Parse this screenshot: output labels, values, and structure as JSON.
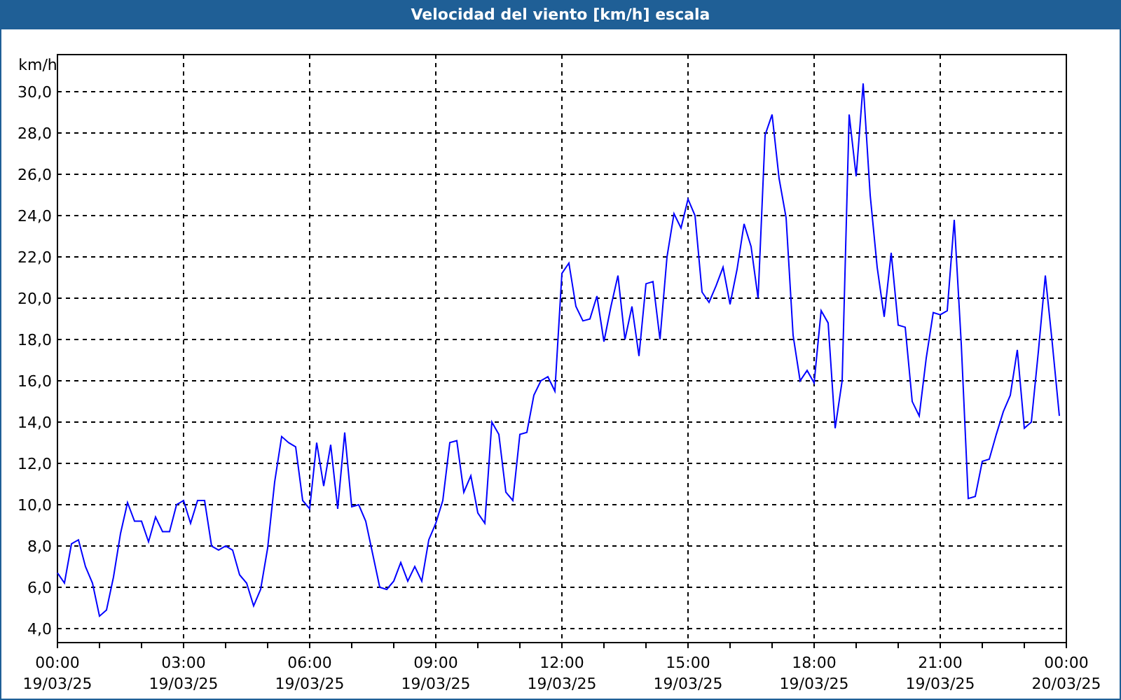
{
  "window": {
    "title": "Velocidad del viento [km/h] escala"
  },
  "chart_data": {
    "type": "line",
    "grid": true,
    "ylabel": "km/h",
    "ylim": [
      3.32,
      31.8
    ],
    "categories": [
      "00:00 19/03/25",
      null,
      null,
      null,
      null,
      null,
      null,
      null,
      null,
      null,
      null,
      null,
      null,
      null,
      null,
      null,
      null,
      null,
      "03:00 19/03/25",
      null,
      null,
      null,
      null,
      null,
      null,
      null,
      null,
      null,
      null,
      null,
      null,
      null,
      null,
      null,
      null,
      null,
      "06:00 19/03/25",
      null,
      null,
      null,
      null,
      null,
      null,
      null,
      null,
      null,
      null,
      null,
      null,
      null,
      null,
      null,
      null,
      null,
      "09:00 19/03/25",
      null,
      null,
      null,
      null,
      null,
      null,
      null,
      null,
      null,
      null,
      null,
      null,
      null,
      null,
      null,
      null,
      null,
      "12:00 19/03/25",
      null,
      null,
      null,
      null,
      null,
      null,
      null,
      null,
      null,
      null,
      null,
      null,
      null,
      null,
      null,
      null,
      null,
      "15:00 19/03/25",
      null,
      null,
      null,
      null,
      null,
      null,
      null,
      null,
      null,
      null,
      null,
      null,
      null,
      null,
      null,
      null,
      null,
      "18:00 19/03/25",
      null,
      null,
      null,
      null,
      null,
      null,
      null,
      null,
      null,
      null,
      null,
      null,
      null,
      null,
      null,
      null,
      null,
      "21:00 19/03/25",
      null,
      null,
      null,
      null,
      null,
      null,
      null,
      null,
      null,
      null,
      null,
      null,
      null,
      null,
      null,
      null,
      null,
      "00:00 20/03/25"
    ],
    "series": [
      {
        "color": "#0000ff",
        "values": [
          6.7,
          6.2,
          8.1,
          8.3,
          7.0,
          6.2,
          4.6,
          4.9,
          6.5,
          8.6,
          10.1,
          9.2,
          9.2,
          8.2,
          9.4,
          8.7,
          8.7,
          10.0,
          10.2,
          9.1,
          10.2,
          10.2,
          8.0,
          7.8,
          8.0,
          7.8,
          6.6,
          6.2,
          5.1,
          5.9,
          7.9,
          11.1,
          13.3,
          13.0,
          12.8,
          10.2,
          9.8,
          13.0,
          10.9,
          12.9,
          9.8,
          13.5,
          9.9,
          10.0,
          9.2,
          7.6,
          6.0,
          5.9,
          6.3,
          7.2,
          6.3,
          7.0,
          6.3,
          8.3,
          9.1,
          10.2,
          13.0,
          13.1,
          10.6,
          11.4,
          9.6,
          9.1,
          14.0,
          13.4,
          10.6,
          10.2,
          13.4,
          13.5,
          15.3,
          16.0,
          16.2,
          15.5,
          21.2,
          21.7,
          19.6,
          18.9,
          19.0,
          20.1,
          17.9,
          19.6,
          21.1,
          18.0,
          19.6,
          17.2,
          20.7,
          20.8,
          18.0,
          22.0,
          24.1,
          23.4,
          24.8,
          24.0,
          20.3,
          19.8,
          20.6,
          21.5,
          19.7,
          21.4,
          23.6,
          22.5,
          20.0,
          27.9,
          28.9,
          25.8,
          23.9,
          18.2,
          16.0,
          16.5,
          15.9,
          19.4,
          18.8,
          13.7,
          16.0,
          28.9,
          25.9,
          30.4,
          25.0,
          21.5,
          19.1,
          22.2,
          18.7,
          18.6,
          15.0,
          14.3,
          17.1,
          19.3,
          19.2,
          19.4,
          23.8,
          17.8,
          10.3,
          10.4,
          12.1,
          12.2,
          13.4,
          14.5,
          15.3,
          17.5,
          13.7,
          14.0,
          17.4,
          21.1,
          17.8,
          14.3,
          null
        ]
      }
    ],
    "yticks": [
      {
        "value": 4,
        "label": "4,0"
      },
      {
        "value": 6,
        "label": "6,0"
      },
      {
        "value": 8,
        "label": "8,0"
      },
      {
        "value": 10,
        "label": "10,0"
      },
      {
        "value": 12,
        "label": "12,0"
      },
      {
        "value": 14,
        "label": "14,0"
      },
      {
        "value": 16,
        "label": "16,0"
      },
      {
        "value": 18,
        "label": "18,0"
      },
      {
        "value": 20,
        "label": "20,0"
      },
      {
        "value": 22,
        "label": "22,0"
      },
      {
        "value": 24,
        "label": "24,0"
      },
      {
        "value": 26,
        "label": "26,0"
      },
      {
        "value": 28,
        "label": "28,0"
      },
      {
        "value": 30,
        "label": "30,0"
      }
    ]
  }
}
